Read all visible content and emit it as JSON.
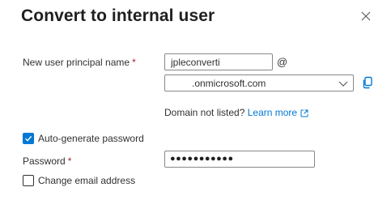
{
  "dialog": {
    "title": "Convert to internal user"
  },
  "form": {
    "upn": {
      "label": "New user principal name",
      "required_marker": "*",
      "value": "jpleconverti",
      "separator": "@"
    },
    "domain": {
      "selected_value": ".onmicrosoft.com",
      "help_text": "Domain not listed?",
      "help_link": "Learn more"
    },
    "auto_generate_password": {
      "label": "Auto-generate password",
      "checked": true
    },
    "password": {
      "label": "Password",
      "required_marker": "*",
      "masked_value": "●●●●●●●●●●●"
    },
    "change_email": {
      "label": "Change email address",
      "checked": false
    }
  },
  "icons": {
    "close": "close-icon",
    "dropdown": "chevron-down-icon",
    "copy": "copy-icon",
    "external_link": "external-link-icon",
    "check": "checkmark-icon"
  },
  "colors": {
    "accent": "#0078d4",
    "required": "#a4262c",
    "text": "#323130",
    "border": "#8a8886"
  }
}
